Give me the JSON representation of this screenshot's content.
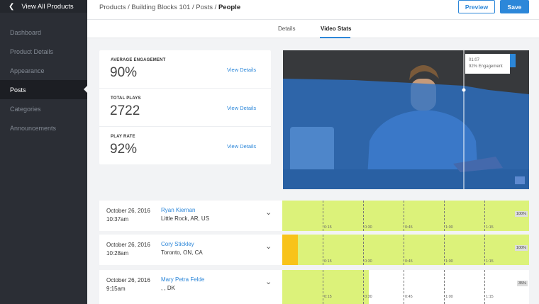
{
  "sidebar": {
    "back_label": "View All Products",
    "items": [
      {
        "label": "Dashboard"
      },
      {
        "label": "Product Details"
      },
      {
        "label": "Appearance"
      },
      {
        "label": "Posts"
      },
      {
        "label": "Categories"
      },
      {
        "label": "Announcements"
      }
    ],
    "active_index": 3
  },
  "breadcrumb": {
    "path": [
      "Products",
      "Building Blocks 101",
      "Posts"
    ],
    "current": "People"
  },
  "toolbar": {
    "preview_label": "Preview",
    "save_label": "Save"
  },
  "tabs": {
    "details": "Details",
    "stats": "Video Stats",
    "active": "Video Stats"
  },
  "stats": [
    {
      "label": "AVERAGE ENGAGEMENT",
      "value": "90%",
      "link": "View Details"
    },
    {
      "label": "TOTAL PLAYS",
      "value": "2722",
      "link": "View Details"
    },
    {
      "label": "PLAY RATE",
      "value": "92%",
      "link": "View Details"
    }
  ],
  "video": {
    "tooltip_time": "01:07",
    "tooltip_engagement": "92% Engagement",
    "engagement_fraction": 0.92,
    "overlay_color": "#2c72c8"
  },
  "sessions": [
    {
      "date": "October 26, 2016",
      "time": "10:37am",
      "name": "Ryan Kiernan",
      "location": "Little Rock, AR, US",
      "percent": "100%",
      "watched_fraction": 1.0,
      "highlight_fraction": 0
    },
    {
      "date": "October 26, 2016",
      "time": "10:28am",
      "name": "Cory Stickley",
      "location": "Toronto, ON, CA",
      "percent": "100%",
      "watched_fraction": 1.0,
      "highlight_fraction": 0.063
    },
    {
      "date": "October 26, 2016",
      "time": "9:15am",
      "name": "Mary Petra Felde",
      "location": ", , DK",
      "percent": "35%",
      "watched_fraction": 0.35,
      "highlight_fraction": 0
    }
  ],
  "timeline_ticks": [
    "0:15",
    "0:30",
    "0:45",
    "1:00",
    "1:15"
  ],
  "colors": {
    "accent": "#2c87d9",
    "watched": "#dcf27a",
    "highlight": "#f8c31a"
  }
}
